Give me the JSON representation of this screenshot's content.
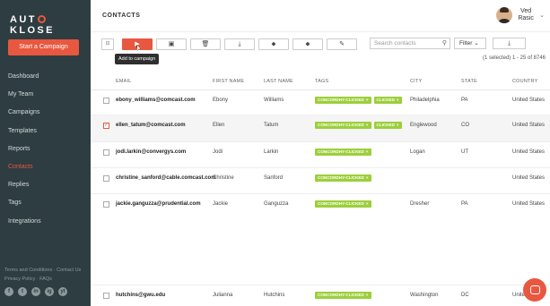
{
  "app": {
    "logo_left": "AUT",
    "logo_o": "O",
    "logo_right": "KLOSE"
  },
  "sidebar": {
    "cta": "Start a Campaign",
    "items": [
      {
        "label": "Dashboard",
        "active": false
      },
      {
        "label": "My Team",
        "active": false
      },
      {
        "label": "Campaigns",
        "active": false
      },
      {
        "label": "Templates",
        "active": false
      },
      {
        "label": "Reports",
        "active": false
      },
      {
        "label": "Contacts",
        "active": true
      },
      {
        "label": "Replies",
        "active": false
      },
      {
        "label": "Tags",
        "active": false
      },
      {
        "label": "Integrations",
        "active": false
      }
    ],
    "footer_line1": "Terms and Conditions · Contact Us",
    "footer_line2": "Privacy Policy · FAQs",
    "socials": [
      "f",
      "t",
      "in",
      "ig",
      "yt"
    ]
  },
  "header": {
    "title": "CONTACTS",
    "user_first": "Ved",
    "user_last": "Rasic"
  },
  "toolbar": {
    "search_placeholder": "Search contacts",
    "filter": "Filter",
    "tooltip": "Add to campaign",
    "selection_info": "(1 selected) 1 - 25 of 8746"
  },
  "table": {
    "headers": {
      "email": "EMAIL",
      "first": "FIRST NAME",
      "last": "LAST NAME",
      "tags": "TAGS",
      "city": "CITY",
      "state": "STATE",
      "country": "COUNTRY"
    },
    "rows": [
      {
        "checked": false,
        "email": "ebony_williams@comcast.com",
        "first": "Ebony",
        "last": "Williams",
        "tags": [
          "CONCORDHY-CLICKED",
          "CLICKED"
        ],
        "city": "Philadelphia",
        "state": "PA",
        "country": "United States"
      },
      {
        "checked": true,
        "email": "ellen_tatum@comcast.com",
        "first": "Ellen",
        "last": "Tatum",
        "tags": [
          "CONCORDHY-CLICKED",
          "CLICKED"
        ],
        "city": "Englewood",
        "state": "CO",
        "country": "United States"
      },
      {
        "checked": false,
        "email": "jodi.larkin@convergys.com",
        "first": "Jodi",
        "last": "Larkin",
        "tags": [
          "CONCORDHY-CLICKED"
        ],
        "city": "Logan",
        "state": "UT",
        "country": "United States"
      },
      {
        "checked": false,
        "email": "christine_sanford@cable.comcast.com",
        "first": "Christine",
        "last": "Sanford",
        "tags": [
          "CONCORDHY-CLICKED"
        ],
        "city": "",
        "state": "",
        "country": "United States"
      },
      {
        "checked": false,
        "email": "jackie.ganguzza@prudential.com",
        "first": "Jackie",
        "last": "Ganguzza",
        "tags": [
          "CONCORDHY-CLICKED"
        ],
        "city": "Dresher",
        "state": "PA",
        "country": "United States"
      },
      {
        "checked": false,
        "email": "hutchins@gwu.edu",
        "first": "Julianna",
        "last": "Hutchins",
        "tags": [
          "CONCORDHY-CLICKED"
        ],
        "city": "Washington",
        "state": "DC",
        "country": "United States"
      }
    ]
  },
  "colors": {
    "accent": "#e8573f",
    "sidebar": "#2e3d41",
    "tag": "#9ccf3b"
  }
}
